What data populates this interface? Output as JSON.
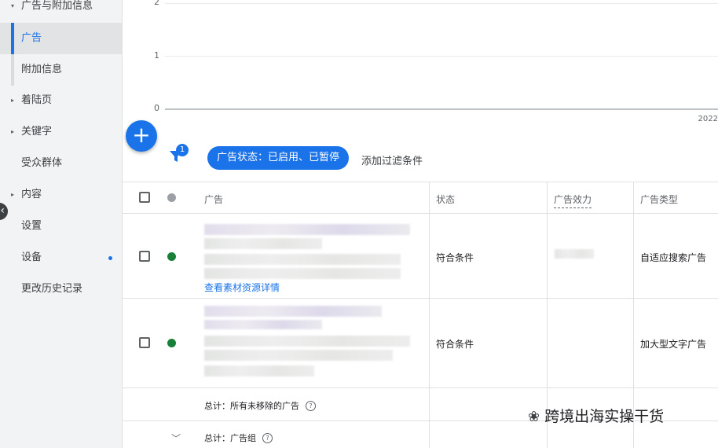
{
  "sidebar": {
    "items": [
      {
        "label": "广告与附加信息",
        "caret": "▾"
      },
      {
        "label": "广告"
      },
      {
        "label": "附加信息"
      },
      {
        "label": "着陆页",
        "caret": "▸"
      },
      {
        "label": "关键字",
        "caret": "▸"
      },
      {
        "label": "受众群体"
      },
      {
        "label": "内容",
        "caret": "▸"
      },
      {
        "label": "设置"
      },
      {
        "label": "设备"
      },
      {
        "label": "更改历史记录"
      }
    ],
    "collapse_icon": "‹"
  },
  "chart": {
    "y_ticks": [
      "2",
      "1",
      "0"
    ],
    "x_label": "2022"
  },
  "toolbar": {
    "add_icon": "+",
    "filter_badge": "1",
    "filter_chip": "广告状态：已启用、已暂停",
    "add_filter": "添加过滤条件"
  },
  "table": {
    "headers": {
      "ad": "广告",
      "status": "状态",
      "strength": "广告效力",
      "type": "广告类型"
    },
    "rows": [
      {
        "status": "符合条件",
        "type": "自适应搜索广告",
        "link": "查看素材资源详情"
      },
      {
        "status": "符合条件",
        "type": "加大型文字广告"
      }
    ],
    "total_all": "总计：所有未移除的广告",
    "total_group": "总计：广告组",
    "help_icon": "?",
    "chevron_icon": "﹀"
  },
  "watermark": {
    "icon": "❀",
    "text": "跨境出海实操干货"
  },
  "colors": {
    "accent": "#1a73e8",
    "status_green": "#188038",
    "sidebar_bg": "#f1f3f4"
  }
}
